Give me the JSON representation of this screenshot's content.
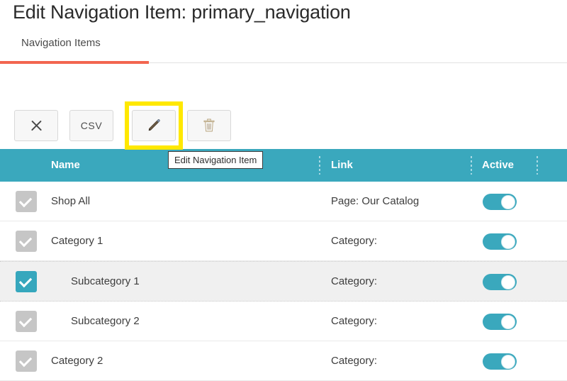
{
  "header": {
    "title": "Edit Navigation Item: primary_navigation"
  },
  "tabs": [
    {
      "label": "Navigation Items",
      "active": true
    }
  ],
  "toolbar": {
    "close_label": "",
    "close_icon": "close-x-icon",
    "csv_label": "CSV",
    "edit_icon": "pencil-icon",
    "delete_icon": "trash-icon",
    "highlight_color": "#ffe800"
  },
  "tooltip": {
    "text": "Edit Navigation Item"
  },
  "table": {
    "columns": [
      "Name",
      "Link",
      "Active"
    ],
    "header_color": "#3aa8bd",
    "rows": [
      {
        "name": "Shop All",
        "link": "Page: Our Catalog",
        "active": true,
        "checked": true,
        "selected": false,
        "indent": 0
      },
      {
        "name": "Category 1",
        "link": "Category:",
        "active": true,
        "checked": true,
        "selected": false,
        "indent": 0
      },
      {
        "name": "Subcategory 1",
        "link": "Category:",
        "active": true,
        "checked": true,
        "selected": true,
        "indent": 1
      },
      {
        "name": "Subcategory 2",
        "link": "Category:",
        "active": true,
        "checked": true,
        "selected": false,
        "indent": 1
      },
      {
        "name": "Category 2",
        "link": "Category:",
        "active": true,
        "checked": true,
        "selected": false,
        "indent": 0
      }
    ]
  }
}
